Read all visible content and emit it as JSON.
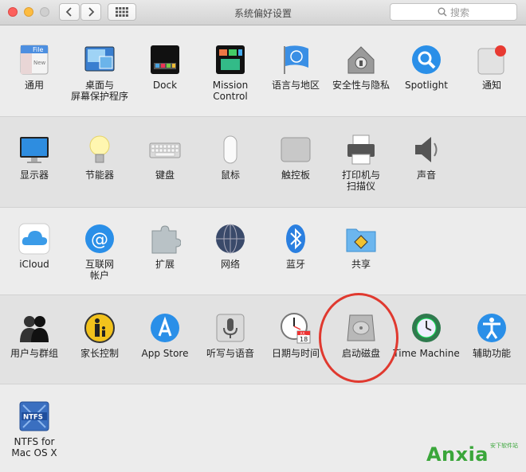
{
  "window": {
    "title": "系统偏好设置"
  },
  "search": {
    "placeholder": "搜索"
  },
  "rows": [
    [
      {
        "name": "general",
        "label": "通用",
        "icon": "general-icon"
      },
      {
        "name": "desktop",
        "label": "桌面与\n屏幕保护程序",
        "icon": "desktop-screensaver-icon"
      },
      {
        "name": "dock",
        "label": "Dock",
        "icon": "dock-icon"
      },
      {
        "name": "mission-control",
        "label": "Mission\nControl",
        "icon": "mission-control-icon"
      },
      {
        "name": "language",
        "label": "语言与地区",
        "icon": "language-region-icon"
      },
      {
        "name": "security",
        "label": "安全性与隐私",
        "icon": "security-privacy-icon"
      },
      {
        "name": "spotlight",
        "label": "Spotlight",
        "icon": "spotlight-icon"
      },
      {
        "name": "notifications",
        "label": "通知",
        "icon": "notifications-icon"
      }
    ],
    [
      {
        "name": "displays",
        "label": "显示器",
        "icon": "displays-icon"
      },
      {
        "name": "energy",
        "label": "节能器",
        "icon": "energy-saver-icon"
      },
      {
        "name": "keyboard",
        "label": "键盘",
        "icon": "keyboard-icon"
      },
      {
        "name": "mouse",
        "label": "鼠标",
        "icon": "mouse-icon"
      },
      {
        "name": "trackpad",
        "label": "触控板",
        "icon": "trackpad-icon"
      },
      {
        "name": "printers",
        "label": "打印机与\n扫描仪",
        "icon": "printer-scanner-icon"
      },
      {
        "name": "sound",
        "label": "声音",
        "icon": "sound-icon"
      }
    ],
    [
      {
        "name": "icloud",
        "label": "iCloud",
        "icon": "icloud-icon"
      },
      {
        "name": "internet-accounts",
        "label": "互联网\n帐户",
        "icon": "internet-accounts-icon"
      },
      {
        "name": "extensions",
        "label": "扩展",
        "icon": "extensions-icon"
      },
      {
        "name": "network",
        "label": "网络",
        "icon": "network-icon"
      },
      {
        "name": "bluetooth",
        "label": "蓝牙",
        "icon": "bluetooth-icon"
      },
      {
        "name": "sharing",
        "label": "共享",
        "icon": "sharing-icon"
      }
    ],
    [
      {
        "name": "users",
        "label": "用户与群组",
        "icon": "users-groups-icon"
      },
      {
        "name": "parental",
        "label": "家长控制",
        "icon": "parental-controls-icon"
      },
      {
        "name": "appstore",
        "label": "App Store",
        "icon": "app-store-icon"
      },
      {
        "name": "dictation",
        "label": "听写与语音",
        "icon": "dictation-speech-icon"
      },
      {
        "name": "datetime",
        "label": "日期与时间",
        "icon": "date-time-icon"
      },
      {
        "name": "startup-disk",
        "label": "启动磁盘",
        "icon": "startup-disk-icon"
      },
      {
        "name": "time-machine",
        "label": "Time Machine",
        "icon": "time-machine-icon"
      },
      {
        "name": "accessibility",
        "label": "辅助功能",
        "icon": "accessibility-icon"
      }
    ],
    [
      {
        "name": "ntfs",
        "label": "NTFS for\nMac OS X",
        "icon": "ntfs-icon"
      }
    ]
  ],
  "calendar_day": "18",
  "calendar_month": "JUL",
  "ntfs_badge": "NTFS",
  "general_file_text": "File",
  "general_new_text": "New",
  "watermark": {
    "brand": "Anxia",
    "sub": "安下软件站"
  },
  "colors": {
    "highlight_circle": "#e0392f",
    "watermark": "#3aa63a"
  }
}
